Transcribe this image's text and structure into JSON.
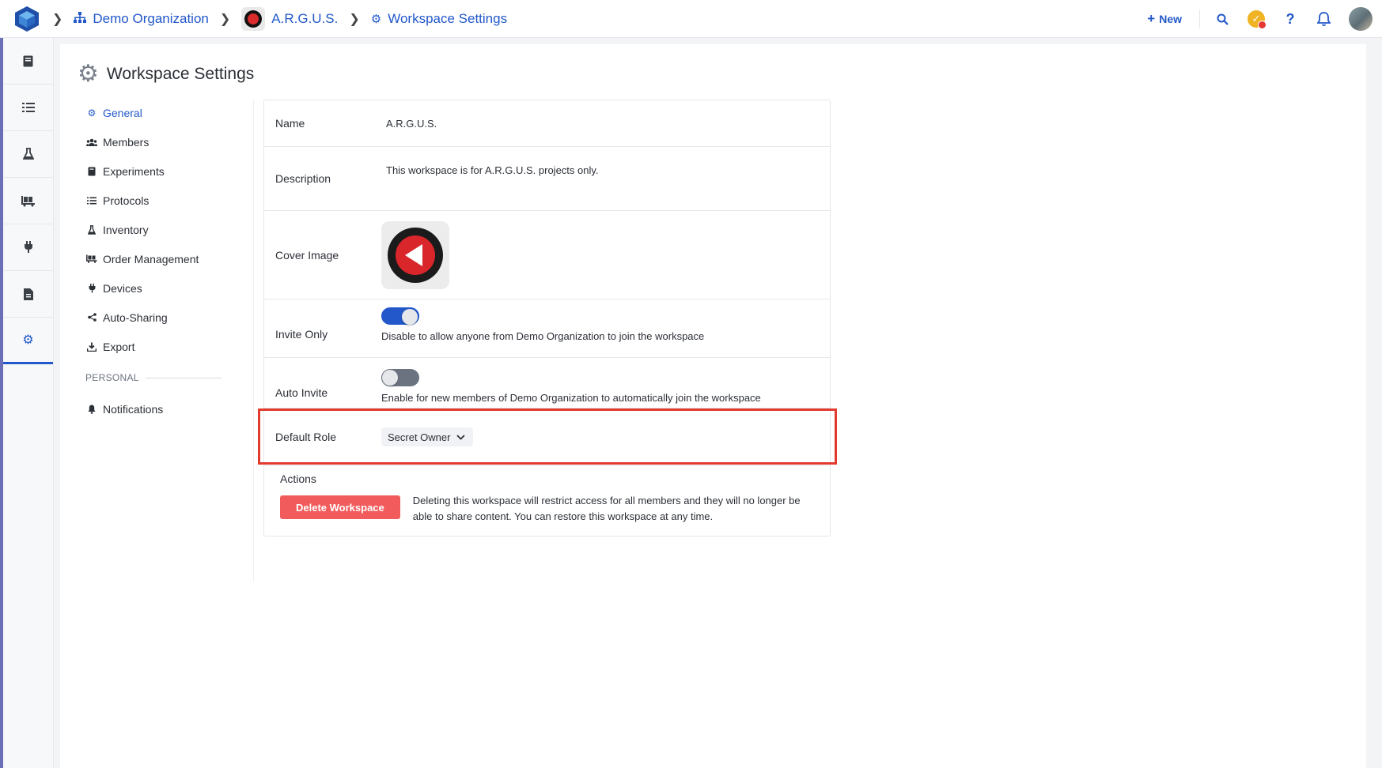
{
  "breadcrumb": {
    "org": "Demo Organization",
    "workspace": "A.R.G.U.S.",
    "current": "Workspace Settings"
  },
  "topbar": {
    "new_label": "New",
    "help_label": "?"
  },
  "page": {
    "title": "Workspace Settings"
  },
  "subnav": {
    "items": [
      {
        "label": "General"
      },
      {
        "label": "Members"
      },
      {
        "label": "Experiments"
      },
      {
        "label": "Protocols"
      },
      {
        "label": "Inventory"
      },
      {
        "label": "Order Management"
      },
      {
        "label": "Devices"
      },
      {
        "label": "Auto-Sharing"
      },
      {
        "label": "Export"
      }
    ],
    "personal_header": "PERSONAL",
    "personal_items": [
      {
        "label": "Notifications"
      }
    ]
  },
  "settings": {
    "name_label": "Name",
    "name_value": "A.R.G.U.S.",
    "description_label": "Description",
    "description_value": "This workspace is for A.R.G.U.S. projects only.",
    "cover_label": "Cover Image",
    "invite_only_label": "Invite Only",
    "invite_only_on": true,
    "invite_only_help": "Disable to allow anyone from Demo Organization to join the workspace",
    "auto_invite_label": "Auto Invite",
    "auto_invite_on": false,
    "auto_invite_help": "Enable for new members of Demo Organization to automatically join the workspace",
    "default_role_label": "Default Role",
    "default_role_value": "Secret Owner"
  },
  "actions": {
    "title": "Actions",
    "delete_label": "Delete Workspace",
    "delete_help": "Deleting this workspace will restrict access for all members and they will no longer be able to share content. You can restore this workspace at any time."
  },
  "colors": {
    "accent": "#2258c9",
    "danger": "#f25b5b",
    "highlight": "#e23b2e"
  }
}
